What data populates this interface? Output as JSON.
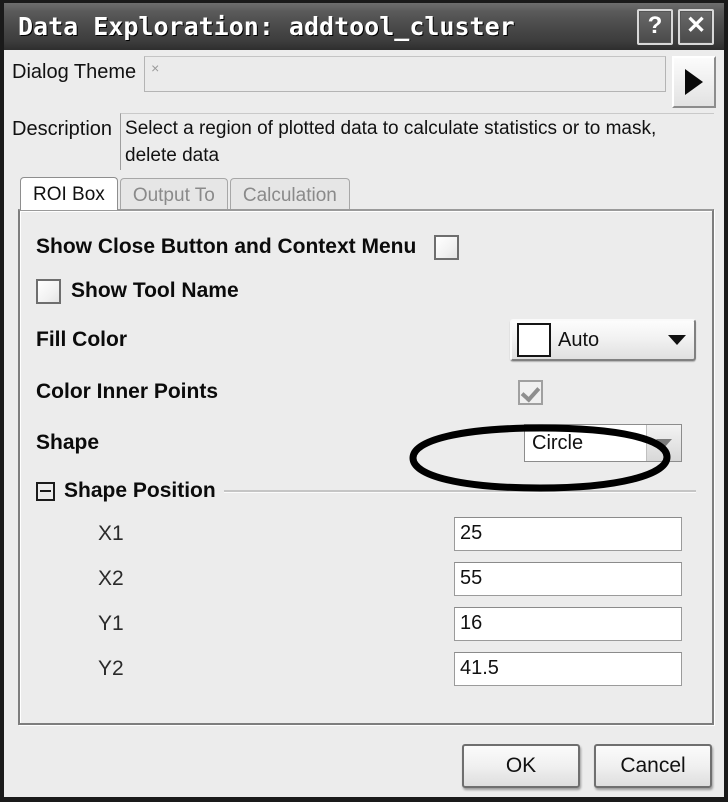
{
  "window": {
    "title": "Data Exploration: addtool_cluster",
    "help_button": "?",
    "close_button": "✕"
  },
  "theme": {
    "label": "Dialog Theme",
    "value": "×",
    "arrow_icon": "play-triangle-icon"
  },
  "description": {
    "label": "Description",
    "text": "Select a region of plotted data to calculate statistics or to mask, delete data"
  },
  "tabs": [
    {
      "label": "ROI Box",
      "active": true
    },
    {
      "label": "Output To",
      "active": false
    },
    {
      "label": "Calculation",
      "active": false
    }
  ],
  "roi_box": {
    "show_close_button": {
      "label": "Show Close Button and Context Menu",
      "checked": false
    },
    "show_tool_name": {
      "label": "Show Tool Name",
      "checked": false
    },
    "fill_color": {
      "label": "Fill Color",
      "value": "Auto",
      "swatch_color": "#ffffff"
    },
    "color_inner_points": {
      "label": "Color Inner Points",
      "checked": true,
      "disabled": true
    },
    "shape": {
      "label": "Shape",
      "value": "Circle"
    },
    "shape_position": {
      "label": "Shape Position",
      "expanded": true,
      "fields": [
        {
          "label": "X1",
          "value": "25"
        },
        {
          "label": "X2",
          "value": "55"
        },
        {
          "label": "Y1",
          "value": "16"
        },
        {
          "label": "Y2",
          "value": "41.5"
        }
      ]
    }
  },
  "footer": {
    "ok_label": "OK",
    "cancel_label": "Cancel"
  },
  "annotation": {
    "type": "hand-drawn-ellipse",
    "target": "shape-dropdown",
    "color": "#000000"
  }
}
